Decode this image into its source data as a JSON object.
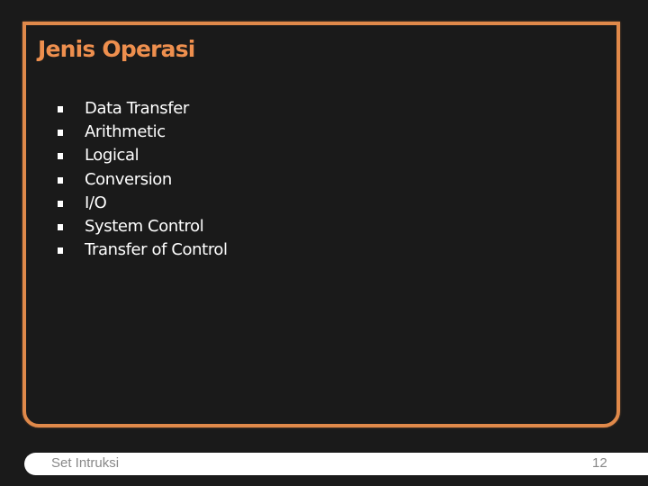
{
  "slide": {
    "title": "Jenis Operasi",
    "bullets": [
      {
        "label": "Data Transfer"
      },
      {
        "label": "Arithmetic"
      },
      {
        "label": "Logical"
      },
      {
        "label": "Conversion"
      },
      {
        "label": "I/O"
      },
      {
        "label": "System Control"
      },
      {
        "label": "Transfer of Control"
      }
    ],
    "bullet_icon": "square-bullet-icon"
  },
  "footer": {
    "title": "Set Intruksi",
    "page_number": "12"
  },
  "colors": {
    "background": "#1a1a1a",
    "accent": "#e0894a",
    "title": "#ee8f4e",
    "text": "#ffffff",
    "footer_text": "#888888"
  }
}
